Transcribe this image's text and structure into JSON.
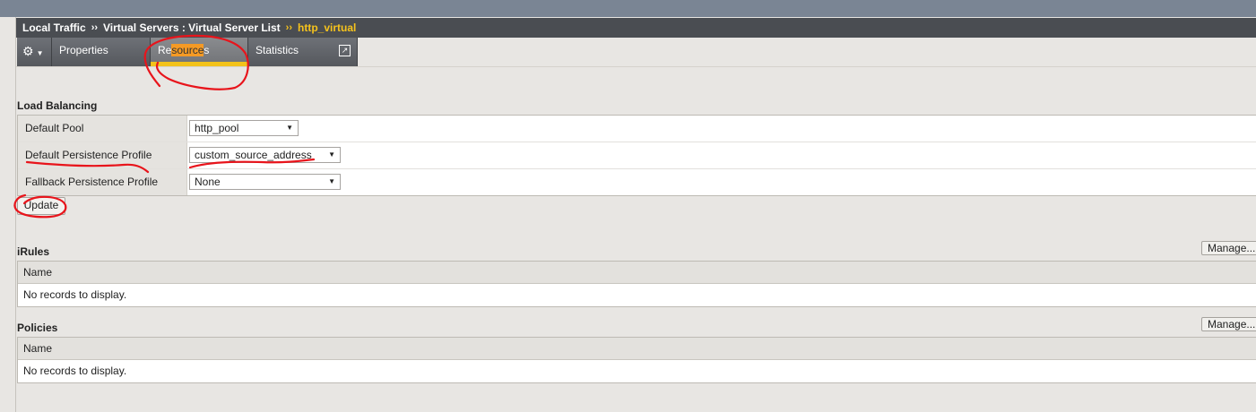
{
  "breadcrumb": {
    "section": "Local Traffic",
    "separator": "››",
    "path": "Virtual Servers : Virtual Server List",
    "current": "http_virtual"
  },
  "tabs": {
    "gear_icon": "gear-icon",
    "properties": "Properties",
    "resources_prefix": "Re",
    "resources_highlight": "source",
    "resources_suffix": "s",
    "statistics": "Statistics",
    "statistics_icon": "external-link-icon"
  },
  "load_balancing": {
    "title": "Load Balancing",
    "rows": [
      {
        "label": "Default Pool",
        "value": "http_pool"
      },
      {
        "label": "Default Persistence Profile",
        "value": "custom_source_address"
      },
      {
        "label": "Fallback Persistence Profile",
        "value": "None"
      }
    ],
    "update_label": "Update"
  },
  "irules": {
    "title": "iRules",
    "manage_label": "Manage...",
    "column": "Name",
    "empty": "No records to display."
  },
  "policies": {
    "title": "Policies",
    "manage_label": "Manage...",
    "column": "Name",
    "empty": "No records to display."
  },
  "colors": {
    "breadcrumb_bg": "#4a4d52",
    "current_crumb": "#f6c31c",
    "active_tab_bar": "#f3c21a",
    "annotation_red": "#e8141b",
    "highlight": "#f59a24"
  }
}
